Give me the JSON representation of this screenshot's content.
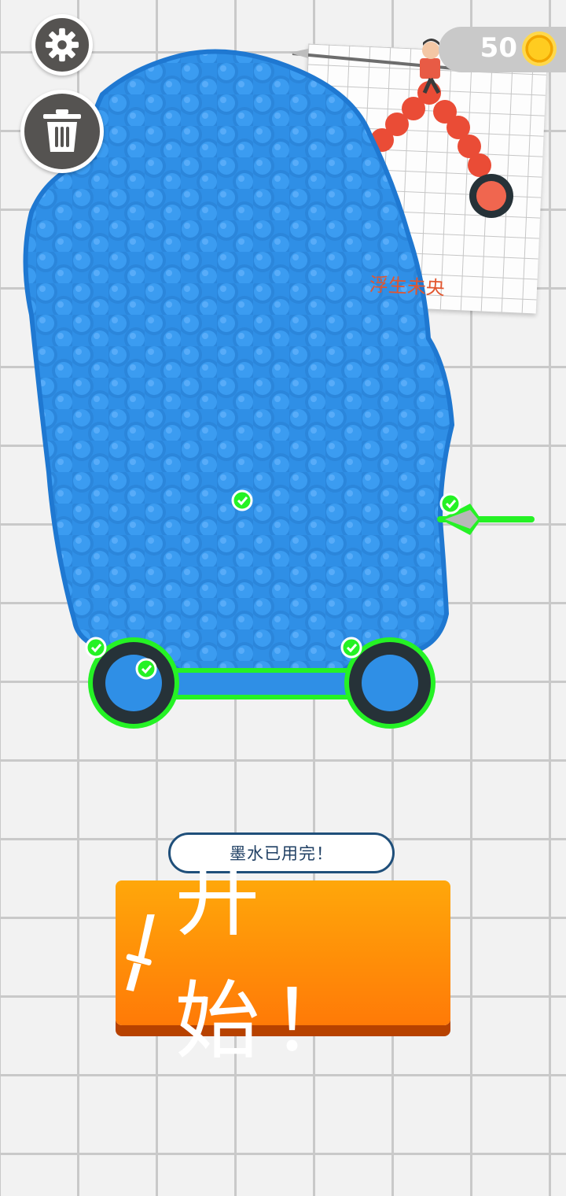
{
  "hud": {
    "coins": "50",
    "settings_icon": "gear-icon",
    "delete_icon": "trash-icon",
    "coin_icon": "coin-icon"
  },
  "level_preview": {
    "author": "浮生未央"
  },
  "game": {
    "ink_color": "#2f8fe6",
    "status_text": "墨水已用完！",
    "start_label": "开始！",
    "start_icon": "sword-icon"
  }
}
